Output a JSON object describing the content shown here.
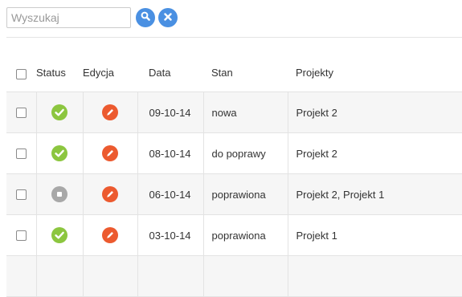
{
  "search": {
    "placeholder": "Wyszukaj",
    "value": "",
    "search_icon": "magnifier-icon",
    "clear_icon": "close-x-icon"
  },
  "table": {
    "headers": {
      "select_all": "",
      "status": "Status",
      "edit": "Edycja",
      "date": "Data",
      "state": "Stan",
      "projects": "Projekty"
    },
    "rows": [
      {
        "status": "approved",
        "status_icon": "checkmark-icon",
        "edit_icon": "pencil-icon",
        "date": "09-10-14",
        "state": "nowa",
        "projects": "Projekt 2"
      },
      {
        "status": "approved",
        "status_icon": "checkmark-icon",
        "edit_icon": "pencil-icon",
        "date": "08-10-14",
        "state": "do poprawy",
        "projects": "Projekt 2"
      },
      {
        "status": "stopped",
        "status_icon": "stop-icon",
        "edit_icon": "pencil-icon",
        "date": "06-10-14",
        "state": "poprawiona",
        "projects": "Projekt 2, Projekt 1"
      },
      {
        "status": "approved",
        "status_icon": "checkmark-icon",
        "edit_icon": "pencil-icon",
        "date": "03-10-14",
        "state": "poprawiona",
        "projects": "Projekt 1"
      }
    ]
  },
  "colors": {
    "button_blue": "#4a90e2",
    "status_green": "#8cc63f",
    "status_gray": "#a8a8a8",
    "edit_orange": "#ec5a2f",
    "row_stripe": "#f6f6f6",
    "border": "#e3e3e3"
  }
}
